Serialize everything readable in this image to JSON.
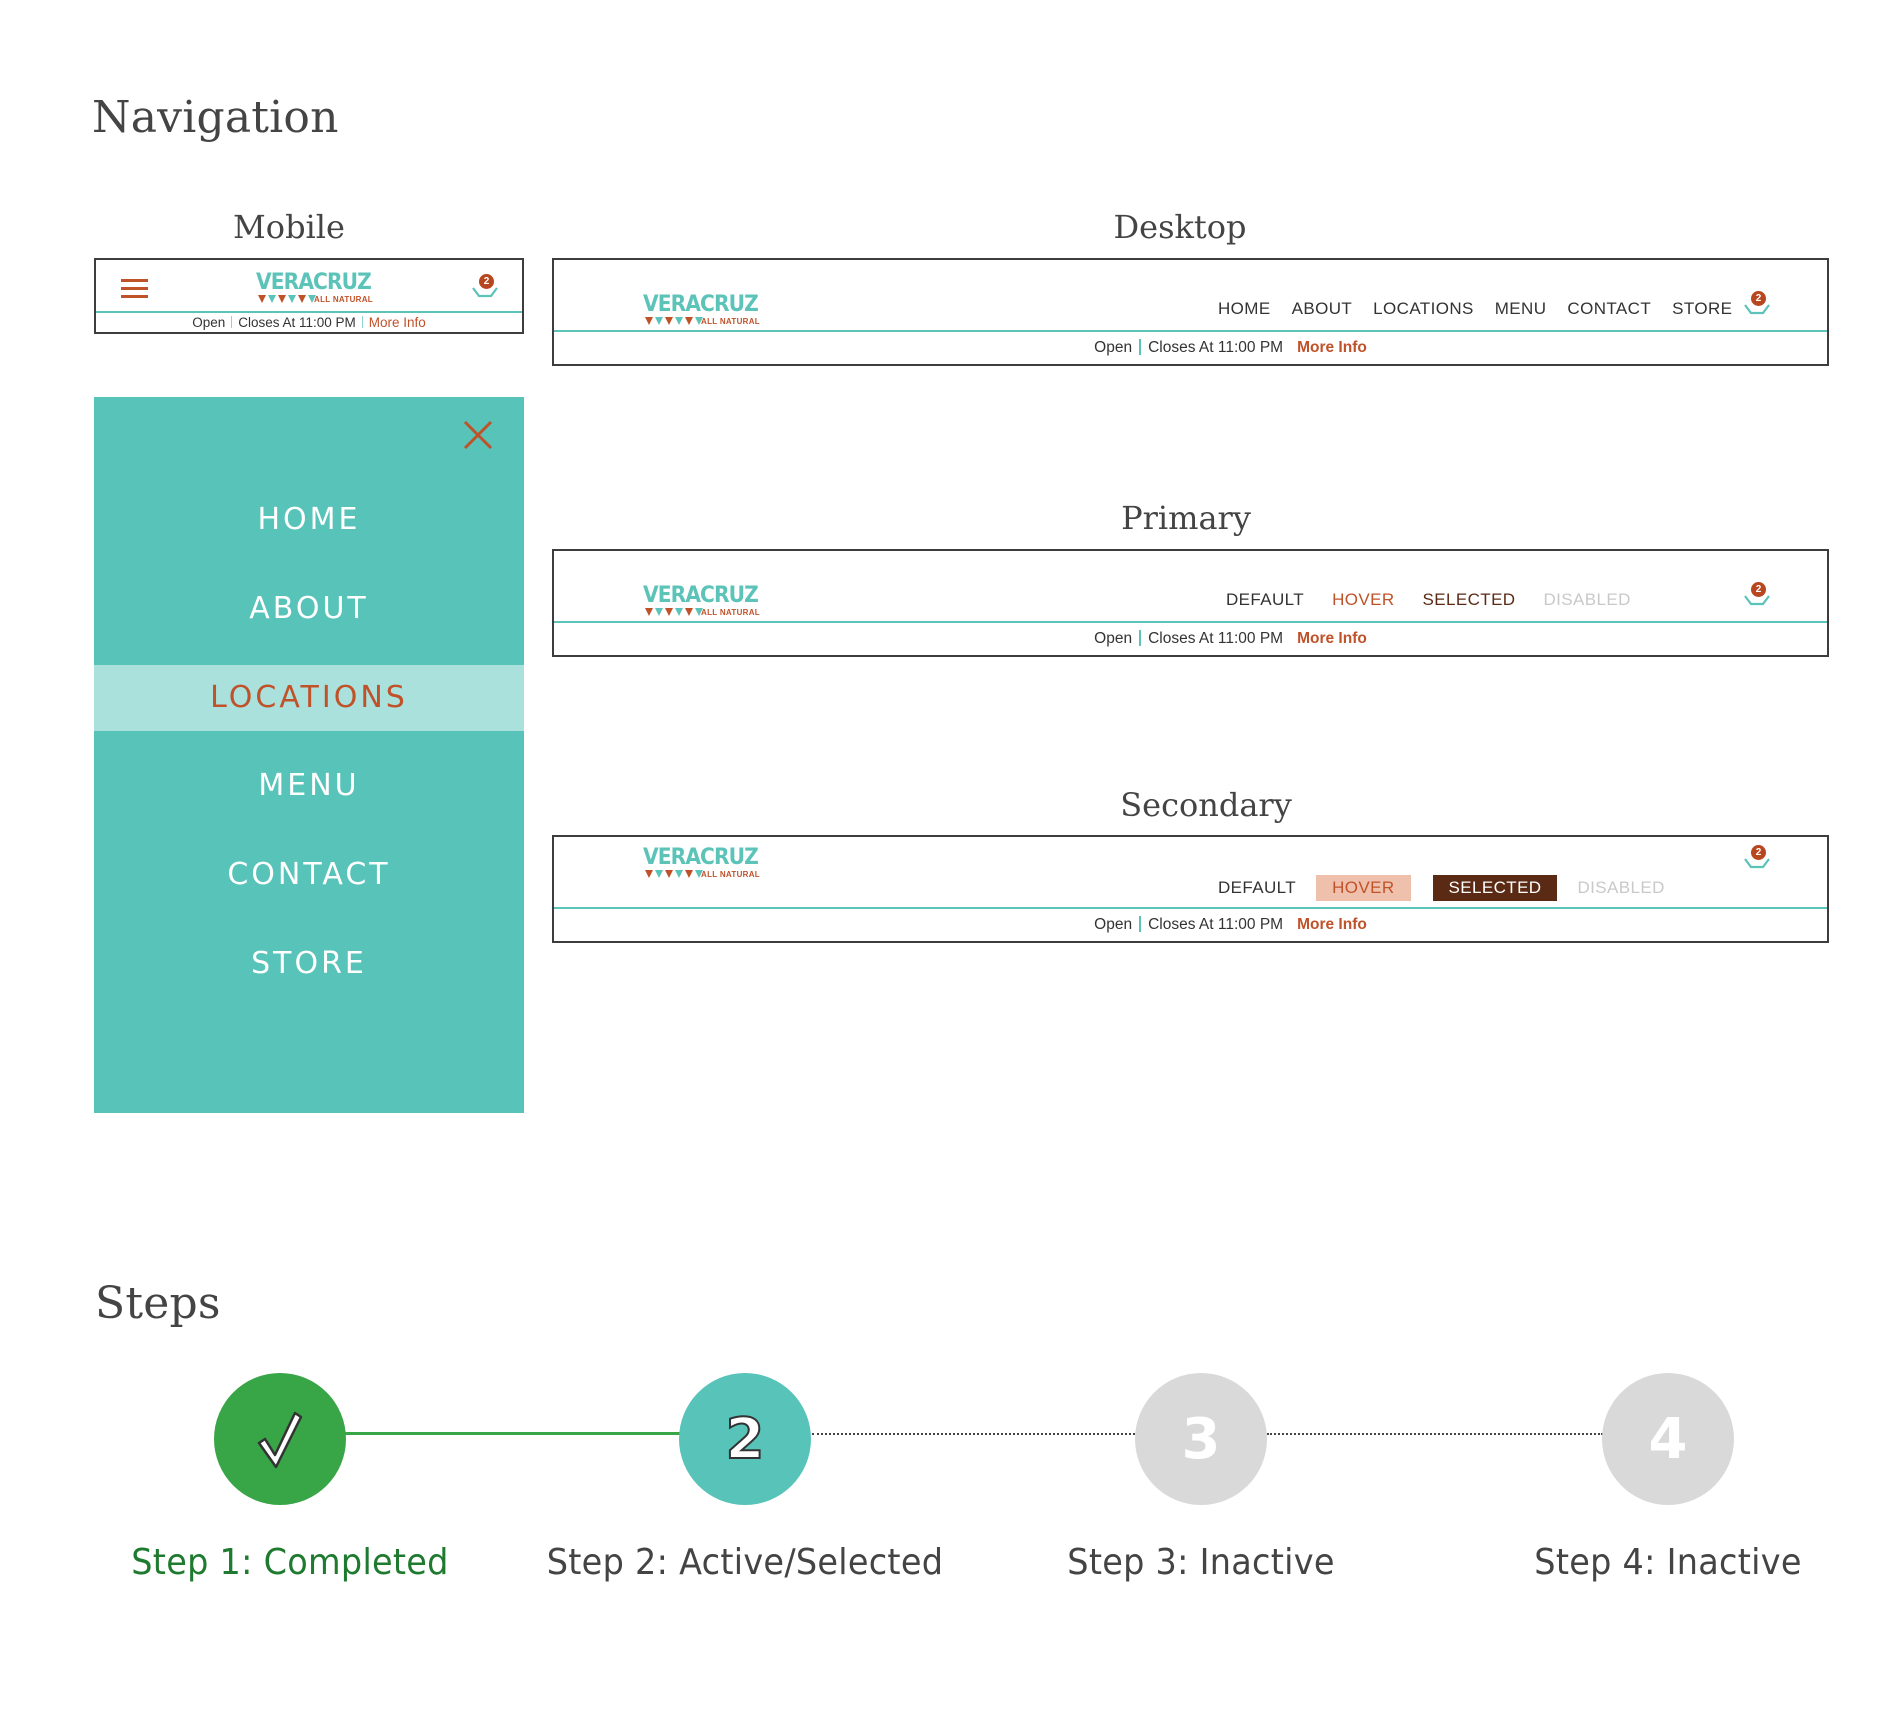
{
  "navigation_section": {
    "title": "Navigation",
    "brand": {
      "name": "VERACRUZ",
      "tagline": "ALL NATURAL",
      "colors": {
        "teal": "#5cc3b9",
        "rust": "#c0522a",
        "dark_brown": "#5a2a14",
        "hover_bg": "#efc1ad",
        "disabled": "#c9c9c9"
      }
    },
    "cart": {
      "icon": "cart-basket-icon",
      "count": "2"
    },
    "info_bar": {
      "open": "Open",
      "closes": "Closes At 11:00 PM",
      "more": "More Info"
    },
    "mobile": {
      "label": "Mobile",
      "menu_icon": "hamburger-icon",
      "close_icon": "close-x-icon",
      "menu_items": [
        {
          "label": "HOME",
          "active": false
        },
        {
          "label": "ABOUT",
          "active": false
        },
        {
          "label": "LOCATIONS",
          "active": true
        },
        {
          "label": "MENU",
          "active": false
        },
        {
          "label": "CONTACT",
          "active": false
        },
        {
          "label": "STORE",
          "active": false
        }
      ]
    },
    "desktop": {
      "label": "Desktop",
      "items": [
        "HOME",
        "ABOUT",
        "LOCATIONS",
        "MENU",
        "CONTACT",
        "STORE"
      ]
    },
    "primary": {
      "label": "Primary",
      "states": {
        "default": "DEFAULT",
        "hover": "HOVER",
        "selected": "SELECTED",
        "disabled": "DISABLED"
      }
    },
    "secondary": {
      "label": "Secondary",
      "states": {
        "default": "DEFAULT",
        "hover": "HOVER",
        "selected": "SELECTED",
        "disabled": "DISABLED"
      }
    }
  },
  "steps_section": {
    "title": "Steps",
    "steps": [
      {
        "number": "1",
        "icon": "checkmark-icon",
        "status": "completed",
        "label": "Step 1: Completed",
        "color": "#38a547"
      },
      {
        "number": "2",
        "status": "active",
        "label": "Step 2: Active/Selected",
        "color": "#57c3b9"
      },
      {
        "number": "3",
        "status": "inactive",
        "label": "Step 3: Inactive",
        "color": "#d9d9d9"
      },
      {
        "number": "4",
        "status": "inactive",
        "label": "Step 4: Inactive",
        "color": "#d9d9d9"
      }
    ]
  }
}
